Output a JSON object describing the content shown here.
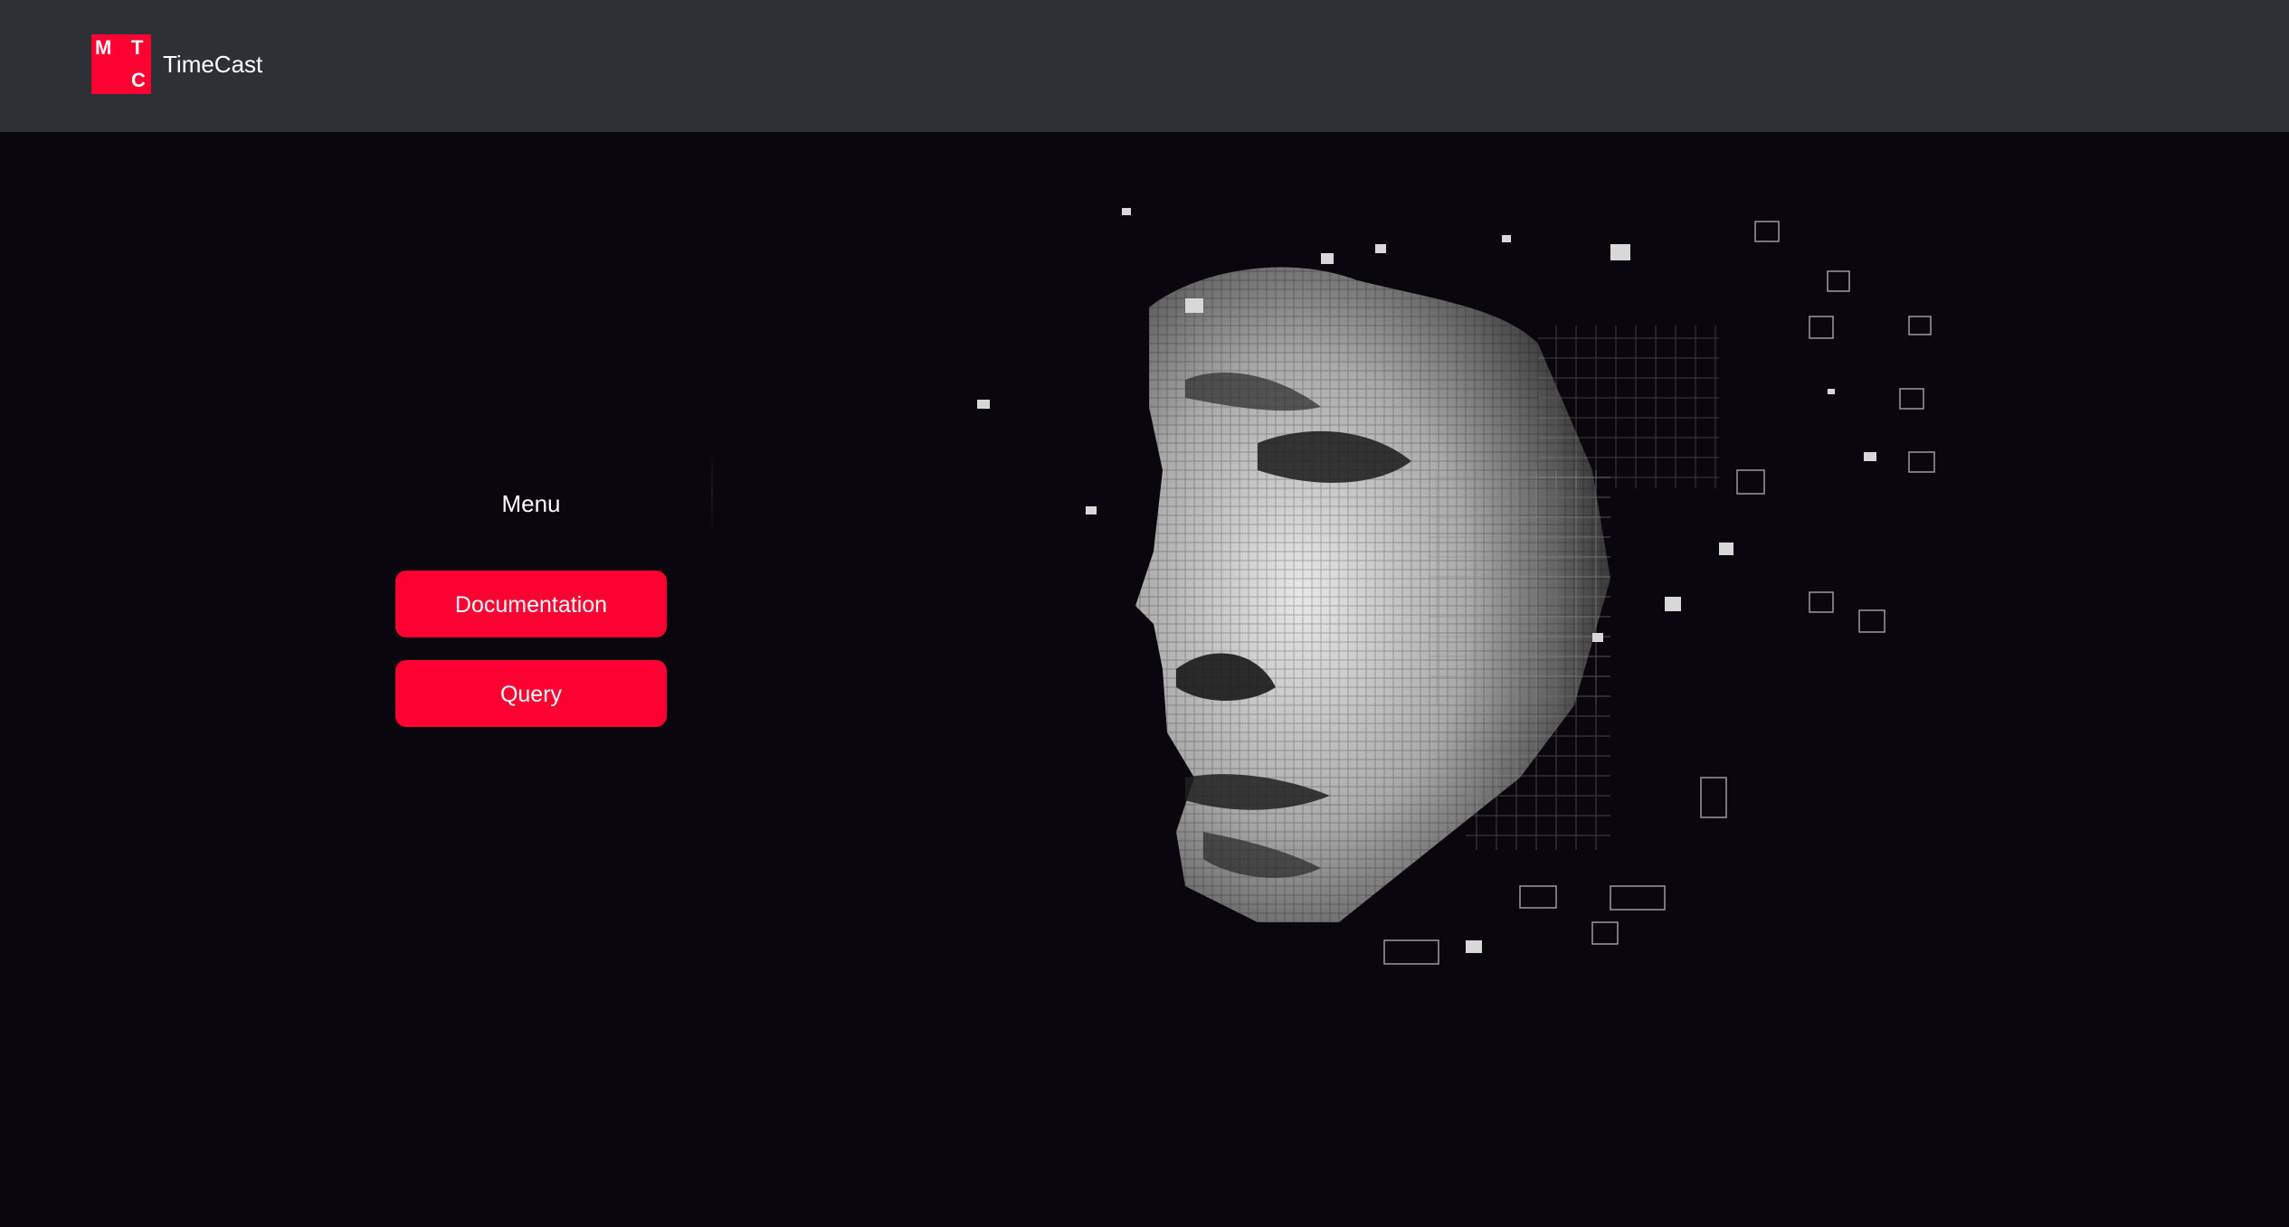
{
  "header": {
    "logo_letters": [
      "М",
      "Т",
      "С"
    ],
    "brand_name": "TimeCast"
  },
  "menu": {
    "title": "Menu",
    "items": [
      {
        "label": "Documentation"
      },
      {
        "label": "Query"
      }
    ]
  },
  "hero": {
    "image": "voxel-face-illustration"
  },
  "colors": {
    "header_bg": "#2d3135",
    "page_bg": "#0a060e",
    "accent": "#ff0032",
    "text": "#ffffff"
  }
}
